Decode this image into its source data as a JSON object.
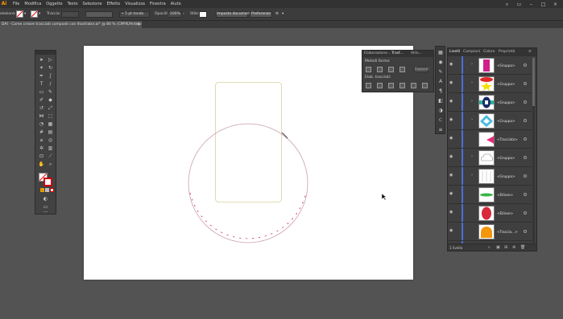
{
  "menubar": {
    "logo": "Ai",
    "items": [
      "File",
      "Modifica",
      "Oggetto",
      "Testo",
      "Selezione",
      "Effetto",
      "Visualizza",
      "Finestra",
      "Aiuto"
    ]
  },
  "controlbar": {
    "selection_label": "elezione",
    "stroke_label": "Traccia:",
    "stroke_profile": "5 pt tondo",
    "opacity_label": "Opacità:",
    "opacity_value": "100%",
    "style_label": "Stile:",
    "doc_setup": "Imposta documento",
    "preferences": "Preferenze"
  },
  "document_tab": {
    "title": "DAI - Come creare tracciati composti con Illustrator.ai* @ 80 % (CMYK/Anteprima)",
    "close": "×"
  },
  "pathfinder": {
    "tabs": [
      "Elaborazione...",
      "Trasf...",
      "Allin..."
    ],
    "shape_modes_label": "Metodi forma:",
    "pathfinder_label": "Elab. tracciati:",
    "expand_label": "Espandi"
  },
  "layers": {
    "tabs": [
      "Livelli",
      "Campioni",
      "Colore",
      "Proprietà"
    ],
    "footer_label": "1 livello",
    "rows": [
      {
        "name": "<Gruppo>"
      },
      {
        "name": "<Gruppo>"
      },
      {
        "name": "<Gruppo>"
      },
      {
        "name": "<Gruppo>"
      },
      {
        "name": "<Tracciato>"
      },
      {
        "name": "<Gruppo>"
      },
      {
        "name": "<Gruppo>"
      },
      {
        "name": "<Ellisse>"
      },
      {
        "name": "<Ellisse>"
      },
      {
        "name": "<Traccia...>"
      }
    ]
  },
  "colors": {
    "canvas_bg": "#535353",
    "artboard": "#ffffff",
    "rect_stroke": "#d8d29a",
    "circle_stroke": "#c9a0a8",
    "circle_handles": "#d4145a",
    "layer_bar": "#4a6fd8"
  }
}
